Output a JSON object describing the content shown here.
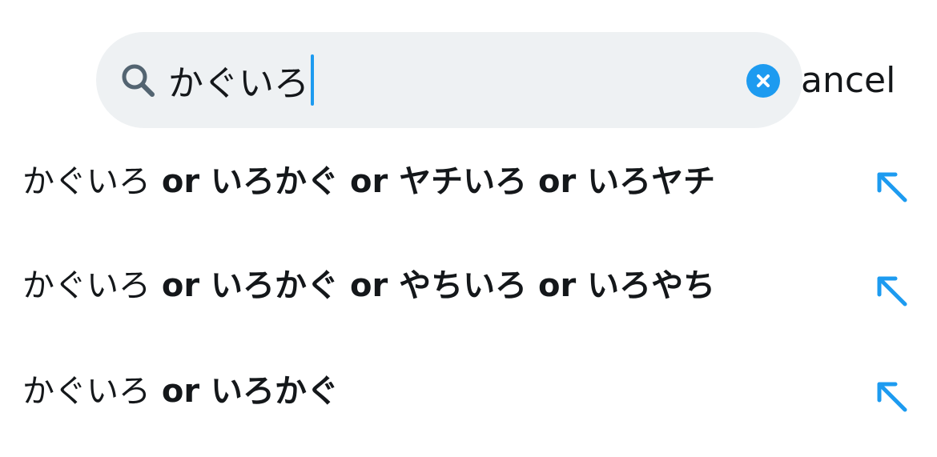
{
  "search": {
    "query": "かぐいろ",
    "cancel_label": "ancel"
  },
  "suggestions": [
    {
      "typed": "かぐいろ",
      "rest": " or いろかぐ or ヤチいろ or いろヤチ"
    },
    {
      "typed": "かぐいろ",
      "rest": " or いろかぐ or やちいろ or いろやち"
    },
    {
      "typed": "かぐいろ",
      "rest": " or いろかぐ"
    }
  ],
  "colors": {
    "accent": "#1d9bf0",
    "search_bg": "#eef1f3",
    "text": "#14171a",
    "icon_gray": "#536471"
  },
  "icons": {
    "search": "search-icon",
    "clear": "clear-icon",
    "fill_suggestion": "arrow-up-left-icon"
  }
}
